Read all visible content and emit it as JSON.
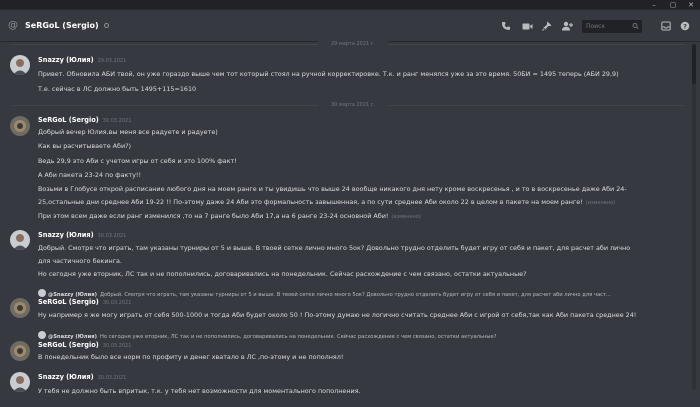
{
  "header": {
    "title": "SeRGoL (Sergio)",
    "search_placeholder": "Поиск"
  },
  "colors": {
    "background": "#36393f",
    "header": "#36393f",
    "titlebar": "#202225",
    "username": "#ffffff",
    "text": "#dcddde",
    "muted": "#72767d"
  },
  "icons": [
    "at-sign-icon",
    "status-offline-icon",
    "voice-call-icon",
    "video-call-icon",
    "pin-icon",
    "add-friend-icon",
    "search-icon",
    "inbox-icon",
    "help-icon",
    "minimize-icon",
    "close-icon"
  ],
  "dividers": [
    "29 марта 2021 г.",
    "30 марта 2021 г."
  ],
  "messages": [
    {
      "author": "Snazzy (Юлия)",
      "time": "29.03.2021",
      "lines": [
        "Привет. Обновила АБИ твой, он уже гораздо выше чем тот который стоял на ручной корректировке. Т.к. и ранг менялся уже за это время. 50БИ = 1495 теперь (АБИ 29,9)",
        "Т.е. сейчас в ЛС должно быть 1495+115=1610"
      ]
    },
    {
      "author": "SeRGoL (Sergio)",
      "time": "30.03.2021",
      "lines": [
        "Добрый вечер Юлия,вы меня все радуете и радуете)",
        "Как вы расчитываете Аби?)",
        "Ведь 29,9 это Аби с учетом игры от себя и это 100% факт!",
        "А Аби пакета 23-24 по факту!!",
        "Возьми в Глобусе открой расписание любого дня на моем ранге и ты увидишь что выше 24 вообще никакого дня нету кроме воскресенья , и то в воскресенье даже Аби 24-",
        "25,остальные дни среднее  Аби 19-22 !! По-этому даже 24 Аби это формальность завышенная, а по сути среднее Аби около 22 в целом в пакете на моем ранге!",
        "При этом всем даже если ранг изменился ,то на 7 ранге было Аби 17,а на 6 ранге 23-24 основной Аби!"
      ],
      "edited_marks": [
        "(изменено)",
        "(изменено)"
      ]
    },
    {
      "author": "Snazzy (Юлия)",
      "time": "30.03.2021",
      "lines": [
        "Добрый. Смотря что играть, там указаны турниры от 5 и выше. В твоей сетке лично много 5ок? Довольно трудно отделить будет игру от себя и пакет, для расчет аби лично",
        "для частичного бекинга.",
        "Но сегодня уже вторник, ЛС так и не пополнились, договаривались на понедельник. Сейчас расхождение с чем связано, остатки актуальные?"
      ]
    },
    {
      "reply_author": "@Snazzy (Юлия)",
      "reply_text": "Добрый. Смотря что играть, там указаны турниры от 5 и выше. В твоей сетке лично много 5ок? Довольно трудно отделить будет игру от себя и пакет, для расчет аби лично для част...",
      "author": "SeRGoL (Sergio)",
      "time": "30.03.2021",
      "lines": [
        "Ну например я же могу играть от себя 500-1000 и тогда Аби будет около 50 ! По-этому думаю не логично считать среднее Аби с игрой от себя,так как Аби пакета среднее 24!"
      ]
    },
    {
      "reply_author": "@Snazzy (Юлия)",
      "reply_text": "Но сегодня уже вторник, ЛС так и не пополнились, договаривались на понедельник. Сейчас расхождение с чем связано, остатки актуальные?",
      "author": "SeRGoL (Sergio)",
      "time": "30.03.2021",
      "lines": [
        "В понедельник было все норм по профиту и денег хватало в ЛС ,по-этому и не пополнял!"
      ]
    },
    {
      "author": "Snazzy (Юлия)",
      "time": "30.03.2021",
      "lines": [
        "У тебя не должно быть впритык, т.к. у тебя нет возможности для моментального пополнения."
      ]
    }
  ]
}
